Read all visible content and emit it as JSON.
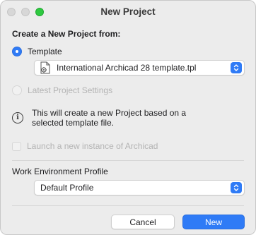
{
  "window": {
    "title": "New Project"
  },
  "section": {
    "title": "Create a New Project from:"
  },
  "options": {
    "template_label": "Template",
    "template_file": "International Archicad 28 template.tpl",
    "latest_label": "Latest Project Settings"
  },
  "info": {
    "text": "This will create a new Project based on a selected template file."
  },
  "launch": {
    "label": "Launch a new instance of Archicad",
    "checked": false
  },
  "profile": {
    "label": "Work Environment Profile",
    "selected": "Default Profile"
  },
  "buttons": {
    "cancel": "Cancel",
    "new": "New"
  },
  "colors": {
    "accent": "#2f7bf6",
    "zoom_button": "#2ec940"
  },
  "icons": {
    "file": "template-file-icon",
    "info": "info-icon",
    "popup_arrows": "updown-chevron-icon"
  }
}
